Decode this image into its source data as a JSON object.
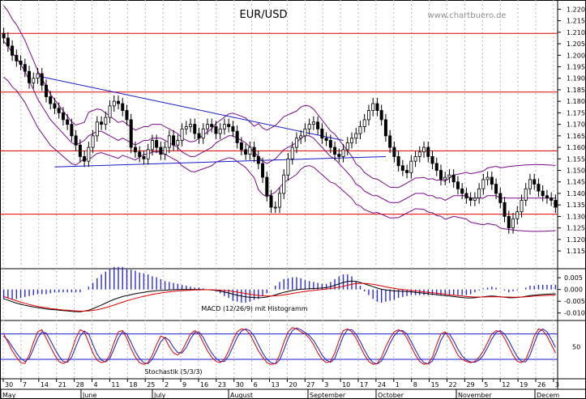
{
  "header": {
    "title": "EUR/USD",
    "website": "www.chartbuero.de"
  },
  "chart_data": [
    {
      "type": "candlestick",
      "title": "EUR/USD",
      "ylim": [
        1.108,
        1.224
      ],
      "y_ticks": [
        "1.220",
        "1.215",
        "1.210",
        "1.205",
        "1.200",
        "1.195",
        "1.190",
        "1.185",
        "1.180",
        "1.175",
        "1.170",
        "1.165",
        "1.160",
        "1.155",
        "1.150",
        "1.145",
        "1.140",
        "1.135",
        "1.130",
        "1.125",
        "1.120",
        "1.115"
      ],
      "horizontal_lines": [
        1.2095,
        1.184,
        1.1585,
        1.131
      ],
      "closes": [
        1.2075,
        1.204,
        1.2,
        1.1975,
        1.196,
        1.193,
        1.188,
        1.19,
        1.192,
        1.187,
        1.182,
        1.179,
        1.177,
        1.175,
        1.172,
        1.17,
        1.165,
        1.161,
        1.156,
        1.154,
        1.16,
        1.165,
        1.171,
        1.17,
        1.173,
        1.178,
        1.18,
        1.179,
        1.176,
        1.172,
        1.16,
        1.158,
        1.156,
        1.155,
        1.159,
        1.163,
        1.16,
        1.157,
        1.16,
        1.165,
        1.161,
        1.163,
        1.168,
        1.169,
        1.17,
        1.166,
        1.164,
        1.168,
        1.17,
        1.169,
        1.166,
        1.168,
        1.17,
        1.169,
        1.167,
        1.162,
        1.159,
        1.157,
        1.16,
        1.156,
        1.153,
        1.147,
        1.139,
        1.134,
        1.134,
        1.14,
        1.148,
        1.155,
        1.16,
        1.164,
        1.165,
        1.168,
        1.17,
        1.171,
        1.168,
        1.164,
        1.163,
        1.16,
        1.157,
        1.156,
        1.159,
        1.162,
        1.164,
        1.166,
        1.169,
        1.172,
        1.176,
        1.179,
        1.176,
        1.172,
        1.165,
        1.16,
        1.156,
        1.152,
        1.15,
        1.149,
        1.154,
        1.156,
        1.158,
        1.16,
        1.156,
        1.153,
        1.15,
        1.146,
        1.147,
        1.148,
        1.145,
        1.142,
        1.14,
        1.138,
        1.137,
        1.138,
        1.142,
        1.146,
        1.147,
        1.144,
        1.14,
        1.136,
        1.13,
        1.125,
        1.129,
        1.132,
        1.137,
        1.142,
        1.146,
        1.144,
        1.141,
        1.139,
        1.138,
        1.137,
        1.134
      ],
      "bollinger_middle": [
        1.206,
        1.204,
        1.201,
        1.199,
        1.196,
        1.193,
        1.189,
        1.185,
        1.181,
        1.178,
        1.175,
        1.172,
        1.17,
        1.168,
        1.166,
        1.164,
        1.162,
        1.161,
        1.162,
        1.163,
        1.165,
        1.166,
        1.167,
        1.167,
        1.166,
        1.165,
        1.164,
        1.163,
        1.164,
        1.163,
        1.162,
        1.161,
        1.162,
        1.163,
        1.163,
        1.164,
        1.164,
        1.164,
        1.163,
        1.162,
        1.161,
        1.16,
        1.158,
        1.157,
        1.156,
        1.156,
        1.157,
        1.158,
        1.159,
        1.16,
        1.162,
        1.163,
        1.164,
        1.165,
        1.165,
        1.164,
        1.163,
        1.162,
        1.16,
        1.158,
        1.156,
        1.154,
        1.153,
        1.154,
        1.155,
        1.157,
        1.159,
        1.16,
        1.161,
        1.162,
        1.164,
        1.165,
        1.165,
        1.164,
        1.162,
        1.16,
        1.158,
        1.156,
        1.155,
        1.153,
        1.151,
        1.149,
        1.147,
        1.144,
        1.143,
        1.141,
        1.14,
        1.139,
        1.139,
        1.138,
        1.137,
        1.136,
        1.136,
        1.136,
        1.137,
        1.138,
        1.139,
        1.14,
        1.14,
        1.14,
        1.139,
        1.139,
        1.138,
        1.138,
        1.137,
        1.138,
        1.139,
        1.139,
        1.139,
        1.139,
        1.138,
        1.138,
        1.138,
        1.138,
        1.139,
        1.139,
        1.139,
        1.138,
        1.138,
        1.138,
        1.138,
        1.138,
        1.138,
        1.138,
        1.138,
        1.138,
        1.138,
        1.138,
        1.138,
        1.138,
        1.138
      ],
      "trendlines": [
        {
          "from": [
            8,
            1.191
          ],
          "to": [
            80,
            1.163
          ]
        },
        {
          "from": [
            12,
            1.1515
          ],
          "to": [
            90,
            1.156
          ]
        }
      ]
    },
    {
      "type": "line",
      "title": "MACD (12/26/9) mit Histogramm",
      "ylim": [
        -0.0125,
        0.0085
      ],
      "y_ticks": [
        "0.005",
        "0.000",
        "-0.005",
        "-0.010"
      ],
      "macd": [
        -0.004,
        -0.0045,
        -0.0052,
        -0.0058,
        -0.0063,
        -0.0067,
        -0.0071,
        -0.0074,
        -0.0077,
        -0.008,
        -0.0083,
        -0.0085,
        -0.0086,
        -0.0088,
        -0.009,
        -0.0091,
        -0.0093,
        -0.0094,
        -0.0095,
        -0.0092,
        -0.0088,
        -0.0082,
        -0.0074,
        -0.0066,
        -0.0058,
        -0.005,
        -0.0042,
        -0.0036,
        -0.003,
        -0.0026,
        -0.0022,
        -0.0018,
        -0.0015,
        -0.0012,
        -0.0009,
        -0.0007,
        -0.0005,
        -0.0004,
        -0.0003,
        -0.0002,
        -0.0001,
        0.0,
        0.0,
        0.0,
        0.0,
        0.0,
        0.0,
        0.0,
        -0.0001,
        -0.0002,
        -0.0004,
        -0.0007,
        -0.0011,
        -0.0015,
        -0.002,
        -0.0024,
        -0.0028,
        -0.0031,
        -0.0033,
        -0.0034,
        -0.0035,
        -0.0034,
        -0.0032,
        -0.0028,
        -0.0023,
        -0.0017,
        -0.0012,
        -0.0008,
        -0.0004,
        -0.0001,
        0.0001,
        0.0002,
        0.0003,
        0.0004,
        0.0005,
        0.0006,
        0.0008,
        0.0012,
        0.0018,
        0.0024,
        0.003,
        0.0034,
        0.0036,
        0.0034,
        0.003,
        0.0024,
        0.0018,
        0.0012,
        0.0006,
        0.0001,
        -0.0002,
        -0.0004,
        -0.0006,
        -0.0007,
        -0.0008,
        -0.0009,
        -0.001,
        -0.0012,
        -0.0014,
        -0.0016,
        -0.0018,
        -0.002,
        -0.0022,
        -0.0024,
        -0.0026,
        -0.0028,
        -0.003,
        -0.0032,
        -0.0034,
        -0.0036,
        -0.0036,
        -0.0035,
        -0.0033,
        -0.0031,
        -0.0029,
        -0.0028,
        -0.0029,
        -0.0031,
        -0.0033,
        -0.0035,
        -0.0035,
        -0.0034,
        -0.0032,
        -0.0029,
        -0.0026,
        -0.0024,
        -0.0022,
        -0.0021,
        -0.002,
        -0.0019,
        -0.0018
      ],
      "signal": [
        -0.003,
        -0.0036,
        -0.0042,
        -0.0048,
        -0.0054,
        -0.0059,
        -0.0064,
        -0.0068,
        -0.0072,
        -0.0075,
        -0.0078,
        -0.0081,
        -0.0083,
        -0.0085,
        -0.0087,
        -0.0088,
        -0.009,
        -0.0091,
        -0.0092,
        -0.0092,
        -0.0091,
        -0.0089,
        -0.0086,
        -0.0082,
        -0.0077,
        -0.0072,
        -0.0066,
        -0.006,
        -0.0054,
        -0.0048,
        -0.0043,
        -0.0038,
        -0.0033,
        -0.0029,
        -0.0025,
        -0.0021,
        -0.0018,
        -0.0015,
        -0.0012,
        -0.001,
        -0.0008,
        -0.0006,
        -0.0005,
        -0.0004,
        -0.0003,
        -0.0002,
        -0.0002,
        -0.0001,
        -0.0001,
        -0.0001,
        -0.0002,
        -0.0003,
        -0.0004,
        -0.0006,
        -0.0008,
        -0.0011,
        -0.0014,
        -0.0017,
        -0.002,
        -0.0023,
        -0.0025,
        -0.0027,
        -0.0028,
        -0.0028,
        -0.0027,
        -0.0025,
        -0.0023,
        -0.002,
        -0.0017,
        -0.0014,
        -0.0011,
        -0.0008,
        -0.0006,
        -0.0004,
        -0.0002,
        0.0,
        0.0002,
        0.0004,
        0.0007,
        0.001,
        0.0014,
        0.0018,
        0.0022,
        0.0025,
        0.0026,
        0.0026,
        0.0024,
        0.0022,
        0.0019,
        0.0015,
        0.0011,
        0.0008,
        0.0005,
        0.0002,
        0.0,
        -0.0002,
        -0.0004,
        -0.0006,
        -0.0008,
        -0.001,
        -0.0012,
        -0.0014,
        -0.0016,
        -0.0018,
        -0.002,
        -0.0022,
        -0.0024,
        -0.0026,
        -0.0028,
        -0.003,
        -0.0031,
        -0.0032,
        -0.0032,
        -0.0032,
        -0.0031,
        -0.0031,
        -0.0031,
        -0.0031,
        -0.0032,
        -0.0032,
        -0.0033,
        -0.0033,
        -0.0032,
        -0.0031,
        -0.003,
        -0.0028,
        -0.0027,
        -0.0026,
        -0.0025,
        -0.0024,
        -0.0023
      ]
    },
    {
      "type": "line",
      "title": "Stochastik (5/3/3)",
      "ylim": [
        -5,
        110
      ],
      "y_ticks": [
        "50"
      ],
      "guide_lines": [
        80,
        20
      ],
      "k": [
        80,
        60,
        40,
        25,
        12,
        10,
        30,
        60,
        85,
        90,
        70,
        50,
        30,
        15,
        10,
        15,
        40,
        70,
        90,
        85,
        60,
        35,
        18,
        12,
        15,
        30,
        60,
        85,
        88,
        70,
        45,
        25,
        12,
        8,
        12,
        30,
        55,
        75,
        70,
        50,
        35,
        30,
        40,
        60,
        80,
        88,
        80,
        60,
        40,
        25,
        15,
        12,
        20,
        40,
        65,
        85,
        92,
        90,
        80,
        60,
        40,
        25,
        12,
        8,
        10,
        30,
        60,
        85,
        95,
        92,
        85,
        80,
        70,
        55,
        35,
        20,
        12,
        15,
        35,
        65,
        88,
        92,
        85,
        70,
        50,
        30,
        15,
        8,
        10,
        25,
        50,
        70,
        85,
        90,
        85,
        70,
        50,
        30,
        15,
        8,
        10,
        25,
        55,
        80,
        85,
        70,
        50,
        30,
        20,
        15,
        12,
        15,
        25,
        40,
        60,
        80,
        88,
        85,
        70,
        50,
        30,
        15,
        12,
        20,
        45,
        75,
        92,
        88,
        75,
        55,
        35
      ],
      "d": [
        75,
        65,
        50,
        35,
        22,
        15,
        22,
        45,
        70,
        85,
        82,
        65,
        45,
        28,
        15,
        13,
        25,
        50,
        75,
        87,
        80,
        55,
        32,
        18,
        14,
        22,
        45,
        70,
        85,
        80,
        60,
        38,
        22,
        12,
        10,
        20,
        40,
        62,
        72,
        65,
        48,
        36,
        35,
        48,
        68,
        84,
        85,
        72,
        52,
        35,
        22,
        15,
        15,
        28,
        50,
        72,
        87,
        92,
        88,
        75,
        55,
        35,
        20,
        12,
        9,
        18,
        42,
        70,
        88,
        94,
        90,
        84,
        76,
        65,
        48,
        30,
        18,
        13,
        22,
        48,
        75,
        90,
        90,
        80,
        62,
        42,
        24,
        12,
        9,
        16,
        35,
        58,
        76,
        87,
        88,
        80,
        62,
        42,
        24,
        12,
        9,
        16,
        38,
        65,
        82,
        80,
        64,
        44,
        28,
        18,
        14,
        13,
        18,
        30,
        48,
        68,
        84,
        88,
        80,
        64,
        44,
        26,
        15,
        14,
        30,
        58,
        84,
        92,
        85,
        68,
        48
      ]
    }
  ],
  "x_axis": {
    "day_labels": [
      "30",
      "7",
      "14",
      "21",
      "28",
      "4",
      "11",
      "18",
      "25",
      "2",
      "9",
      "16",
      "23",
      "30",
      "6",
      "13",
      "20",
      "27",
      "3",
      "10",
      "17",
      "24",
      "1",
      "8",
      "15",
      "22",
      "29",
      "5",
      "12",
      "19",
      "26",
      "3"
    ],
    "month_labels": [
      "May",
      "June",
      "July",
      "August",
      "September",
      "October",
      "November",
      "Decem"
    ]
  },
  "colors": {
    "candle": "#000000",
    "bollinger": "#7a0d8a",
    "support_resistance": "#e00000",
    "trendline": "#1a1ac8",
    "macd_line": "#000000",
    "signal_line": "#e00000",
    "histogram": "#2a2ae0",
    "stoch_k": "#e00000",
    "stoch_d": "#1a1ac8",
    "grid": "#b8b8b8"
  }
}
